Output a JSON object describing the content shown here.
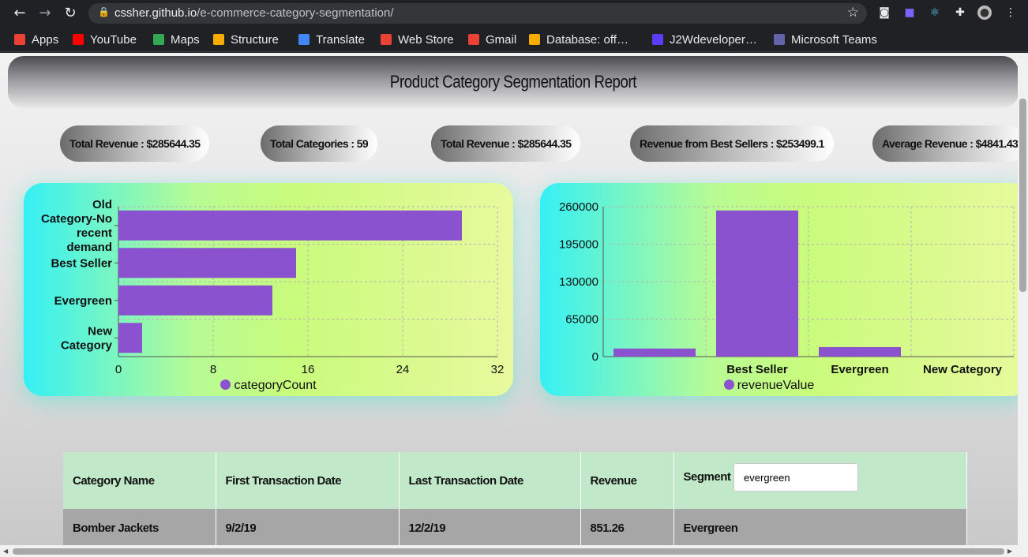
{
  "browser": {
    "url_host": "cssher.github.io",
    "url_path": "/e-commerce-category-segmentation/",
    "icons": [
      "back-icon",
      "forward-icon",
      "reload-icon",
      "lock-icon",
      "star-icon",
      "camera-icon",
      "extension-icon",
      "react-icon",
      "puzzle-icon",
      "profile-avatar",
      "menu-icon"
    ]
  },
  "bookmarks": [
    {
      "label": "Apps",
      "color": "#ea4335"
    },
    {
      "label": "YouTube",
      "color": "#ff0000"
    },
    {
      "label": "Maps",
      "color": "#34a853"
    },
    {
      "label": "Structure",
      "color": "#f9ab00"
    },
    {
      "label": "Translate",
      "color": "#4285f4"
    },
    {
      "label": "Web Store",
      "color": "#ea4335"
    },
    {
      "label": "Gmail",
      "color": "#ea4335"
    },
    {
      "label": "Database: off…",
      "color": "#f9ab00"
    },
    {
      "label": "J2Wdeveloper…",
      "color": "#5b3df5"
    },
    {
      "label": "Microsoft Teams",
      "color": "#6264a7"
    }
  ],
  "page": {
    "title": "Product Category Segmentation Report",
    "stats": [
      "Total Revenue : $285644.35",
      "Total Categories : 59",
      "Total Revenue : $285644.35",
      "Revenue from Best Sellers : $253499.1",
      "Average Revenue : $4841.43"
    ]
  },
  "chart_data": [
    {
      "type": "bar",
      "orientation": "horizontal",
      "categories": [
        "Old Category-No recent demand",
        "Best Seller",
        "Evergreen",
        "New Category"
      ],
      "series": [
        {
          "name": "categoryCount",
          "values": [
            29,
            15,
            13,
            2
          ]
        }
      ],
      "xlim": [
        0,
        32
      ],
      "xticks": [
        "0",
        "8",
        "16",
        "24",
        "32"
      ],
      "grid": true,
      "legend": "bottom",
      "color": "#8a52cf"
    },
    {
      "type": "bar",
      "categories": [
        "",
        "Best Seller",
        "Evergreen",
        "New Category"
      ],
      "series": [
        {
          "name": "revenueValue",
          "values": [
            14000,
            253499.1,
            16500,
            0
          ]
        }
      ],
      "ylim": [
        0,
        260000
      ],
      "yticks": [
        "0",
        "65000",
        "130000",
        "195000",
        "260000"
      ],
      "grid": true,
      "legend": "bottom",
      "color": "#8a52cf"
    }
  ],
  "table": {
    "headers": [
      "Category Name",
      "First Transaction Date",
      "Last Transaction Date",
      "Revenue",
      "Segment"
    ],
    "segment_filter_value": "evergreen",
    "rows": [
      [
        "Bomber Jackets",
        "9/2/19",
        "12/2/19",
        "851.26",
        "Evergreen"
      ]
    ]
  }
}
